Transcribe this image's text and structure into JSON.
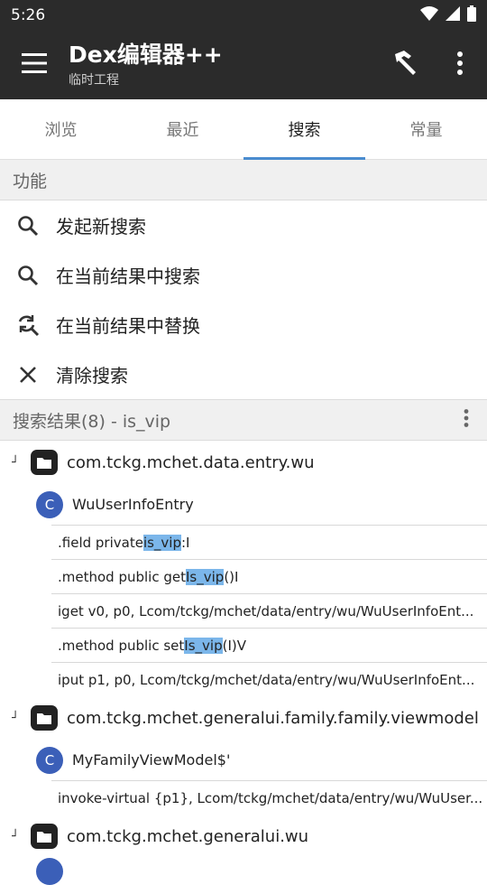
{
  "status": {
    "time": "5:26"
  },
  "appbar": {
    "title": "Dex编辑器++",
    "subtitle": "临时工程"
  },
  "tabs": [
    "浏览",
    "最近",
    "搜索",
    "常量"
  ],
  "active_tab": 2,
  "functions": {
    "header": "功能",
    "items": [
      {
        "label": "发起新搜索",
        "icon": "search-icon"
      },
      {
        "label": "在当前结果中搜索",
        "icon": "search-icon"
      },
      {
        "label": "在当前结果中替换",
        "icon": "replace-icon"
      },
      {
        "label": "清除搜索",
        "icon": "close-icon"
      }
    ]
  },
  "results": {
    "header": "搜索结果(8) - is_vip",
    "groups": [
      {
        "package": "com.tckg.mchet.data.entry.wu",
        "class": "WuUserInfoEntry",
        "lines": [
          {
            "pre": ".field private ",
            "match": "is_vip",
            "post": ":I"
          },
          {
            "pre": ".method public get",
            "match": "Is_vip",
            "post": "()I"
          },
          {
            "pre": "iget v0, p0, Lcom/tckg/mchet/data/entry/wu/WuUserInfoEnt...",
            "match": "",
            "post": ""
          },
          {
            "pre": ".method public set",
            "match": "Is_vip",
            "post": "(I)V"
          },
          {
            "pre": "iput p1, p0, Lcom/tckg/mchet/data/entry/wu/WuUserInfoEnt...",
            "match": "",
            "post": ""
          }
        ]
      },
      {
        "package": "com.tckg.mchet.generalui.family.family.viewmodel",
        "class": "MyFamilyViewModel$'",
        "lines": [
          {
            "pre": "invoke-virtual {p1}, Lcom/tckg/mchet/data/entry/wu/WuUser...",
            "match": "",
            "post": ""
          }
        ]
      },
      {
        "package": "com.tckg.mchet.generalui.wu",
        "class": "",
        "lines": []
      }
    ]
  },
  "class_badge": "C",
  "expand_glyph": "┘"
}
